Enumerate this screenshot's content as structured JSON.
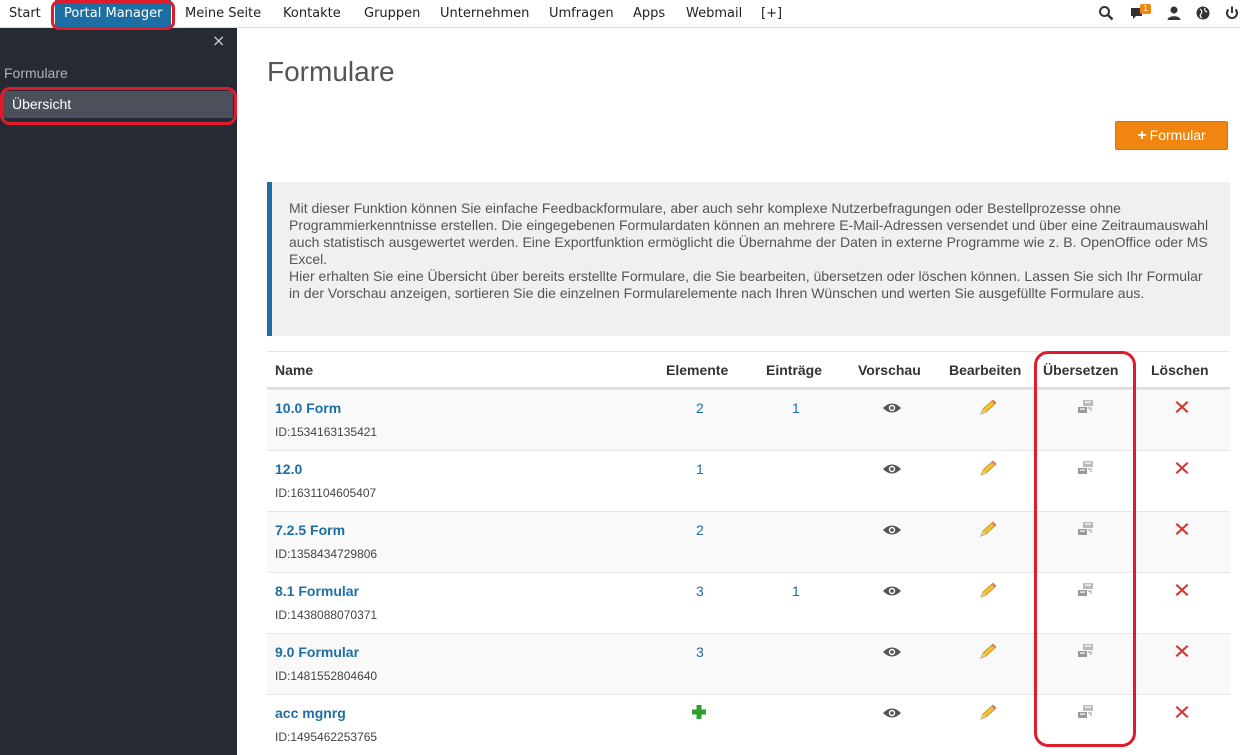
{
  "nav": {
    "items": [
      "Start",
      "Portal Manager",
      "Meine Seite",
      "Kontakte",
      "Gruppen",
      "Unternehmen",
      "Umfragen",
      "Apps",
      "Webmail",
      "[+]"
    ],
    "active": "Portal Manager",
    "notification_count": "1"
  },
  "sidebar": {
    "close": "×",
    "section": "Formulare",
    "items": [
      "Übersicht"
    ]
  },
  "main": {
    "title": "Formulare",
    "add_button_label": "Formular",
    "info_paragraph_1": "Mit dieser Funktion können Sie einfache Feedbackformulare, aber auch sehr komplexe Nutzerbefragungen oder Bestellprozesse ohne Programmierkenntnisse erstellen. Die eingegebenen Formulardaten können an mehrere E-Mail-Adressen versendet und über eine Zeitraumauswahl auch statistisch ausgewertet werden. Eine Exportfunktion ermöglicht die Übernahme der Daten in externe Programme wie z. B. OpenOffice oder MS Excel.",
    "info_paragraph_2": "Hier erhalten Sie eine Übersicht über bereits erstellte Formulare, die Sie bearbeiten, übersetzen oder löschen können. Lassen Sie sich Ihr Formular in der Vorschau anzeigen, sortieren Sie die einzelnen Formularelemente nach Ihren Wünschen und werten Sie ausgefüllte Formulare aus."
  },
  "table": {
    "headers": {
      "name": "Name",
      "elements": "Elemente",
      "entries": "Einträge",
      "preview": "Vorschau",
      "edit": "Bearbeiten",
      "translate": "Übersetzen",
      "delete": "Löschen"
    },
    "rows": [
      {
        "name": "10.0 Form",
        "id": "ID:1534163135421",
        "elements": "2",
        "entries": "1"
      },
      {
        "name": "12.0",
        "id": "ID:1631104605407",
        "elements": "1",
        "entries": ""
      },
      {
        "name": "7.2.5 Form",
        "id": "ID:1358434729806",
        "elements": "2",
        "entries": ""
      },
      {
        "name": "8.1 Formular",
        "id": "ID:1438088070371",
        "elements": "3",
        "entries": "1"
      },
      {
        "name": "9.0 Formular",
        "id": "ID:1481552804640",
        "elements": "3",
        "entries": ""
      },
      {
        "name": "acc mgnrg",
        "id": "ID:1495462253765",
        "elements": "",
        "entries": "",
        "elements_icon": "add-icon"
      }
    ]
  },
  "colors": {
    "brand_blue": "#1d6fa3",
    "orange": "#f0860f",
    "highlight_red": "#e01b2b",
    "sidebar_bg": "#252a33"
  }
}
